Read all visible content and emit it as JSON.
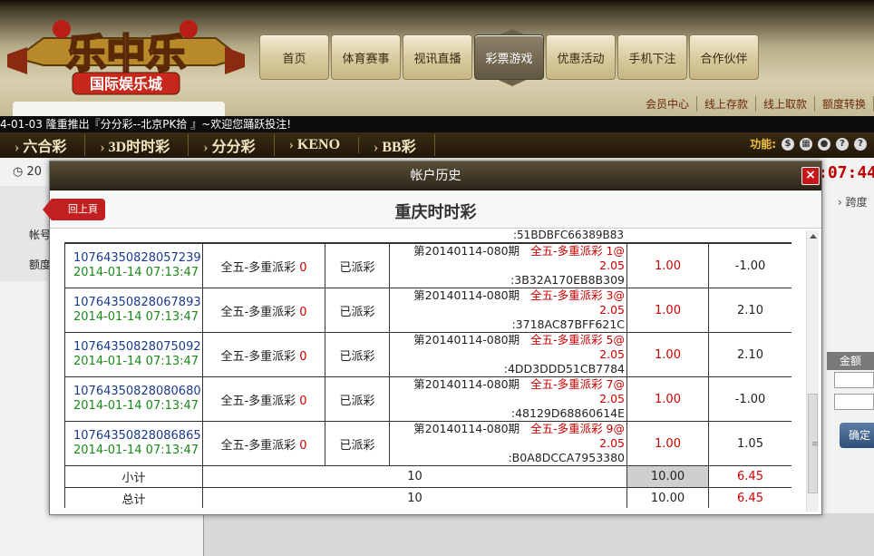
{
  "logo": {
    "main": "乐中乐",
    "sub": "国际娱乐城"
  },
  "nav": [
    {
      "label": "首页"
    },
    {
      "label": "体育赛事"
    },
    {
      "label": "视讯直播"
    },
    {
      "label": "彩票游戏"
    },
    {
      "label": "优惠活动"
    },
    {
      "label": "手机下注"
    },
    {
      "label": "合作伙伴"
    }
  ],
  "top_links": [
    "会员中心",
    "线上存款",
    "线上取款",
    "额度转换"
  ],
  "marquee": "4-01-03 隆重推出『分分彩--北京PK拾 』~欢迎您踊跃投注!",
  "games": [
    "六合彩",
    "3D时时彩",
    "分分彩",
    "KENO",
    "BB彩"
  ],
  "func_label": "功能:",
  "clock_text": "20",
  "timer": ":07:44",
  "right_link": "› 跨度",
  "left_items": [
    "帐号",
    "额度"
  ],
  "amount_header": "金额",
  "confirm_label": "确定",
  "modal": {
    "title": "帐户历史",
    "close": "×",
    "back": "回上頁",
    "subtitle": "重庆时时彩",
    "cut_text": ":51BDBFC66389B83",
    "rows": [
      {
        "id": "10764350828057239",
        "time": "2014-01-14 07:13:47",
        "type": "全五-多重派彩",
        "type_num": "0",
        "status": "已派彩",
        "period": "第20140114-080期",
        "bet": "全五-多重派彩 1@",
        "odds": "2.05",
        "code": ":3B32A170EB8B309",
        "amount": "1.00",
        "result": "-1.00"
      },
      {
        "id": "10764350828067893",
        "time": "2014-01-14 07:13:47",
        "type": "全五-多重派彩",
        "type_num": "0",
        "status": "已派彩",
        "period": "第20140114-080期",
        "bet": "全五-多重派彩 3@",
        "odds": "2.05",
        "code": ":3718AC87BFF621C",
        "amount": "1.00",
        "result": "2.10"
      },
      {
        "id": "10764350828075092",
        "time": "2014-01-14 07:13:47",
        "type": "全五-多重派彩",
        "type_num": "0",
        "status": "已派彩",
        "period": "第20140114-080期",
        "bet": "全五-多重派彩 5@",
        "odds": "2.05",
        "code": ":4DD3DDD51CB7784",
        "amount": "1.00",
        "result": "2.10"
      },
      {
        "id": "10764350828080680",
        "time": "2014-01-14 07:13:47",
        "type": "全五-多重派彩",
        "type_num": "0",
        "status": "已派彩",
        "period": "第20140114-080期",
        "bet": "全五-多重派彩 7@",
        "odds": "2.05",
        "code": ":48129D68860614E",
        "amount": "1.00",
        "result": "-1.00"
      },
      {
        "id": "10764350828086865",
        "time": "2014-01-14 07:13:47",
        "type": "全五-多重派彩",
        "type_num": "0",
        "status": "已派彩",
        "period": "第20140114-080期",
        "bet": "全五-多重派彩 9@",
        "odds": "2.05",
        "code": ":B0A8DCCA7953380",
        "amount": "1.00",
        "result": "1.05"
      }
    ],
    "subtotal": {
      "label": "小计",
      "count": "10",
      "amount": "10.00",
      "result": "6.45"
    },
    "total": {
      "label": "总计",
      "count": "10",
      "amount": "10.00",
      "result": "6.45"
    }
  }
}
